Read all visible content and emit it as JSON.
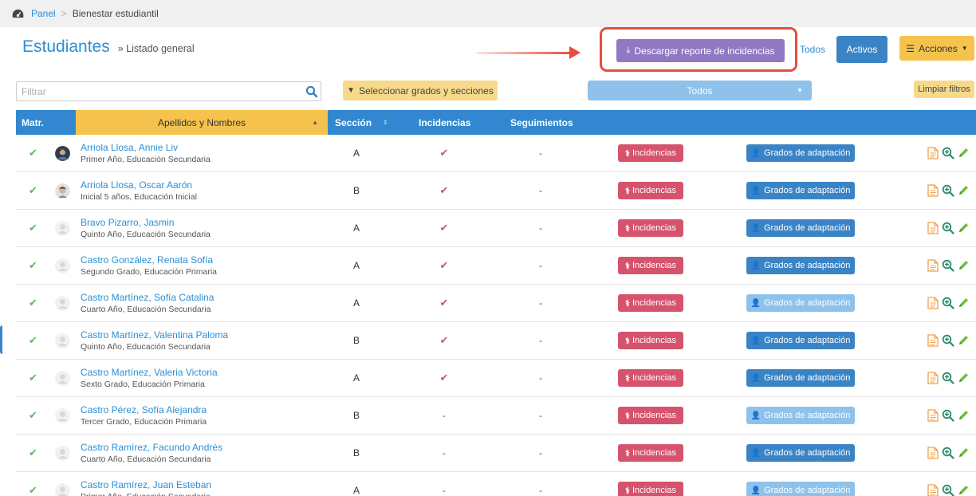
{
  "breadcrumb": {
    "home_icon": "dashboard-icon",
    "link": "Panel",
    "separator": ">",
    "current": "Bienestar estudiantil"
  },
  "page": {
    "title": "Estudiantes",
    "subtitle": "» Listado general"
  },
  "toolbar": {
    "download_icon": "download-icon",
    "download_label": "Descargar reporte de incidencias",
    "todos_label": "Todos",
    "activos_label": "Activos",
    "acciones_label": "Acciones",
    "acciones_icon": "list-icon"
  },
  "filters": {
    "search_placeholder": "Filtrar",
    "grados_label": "Seleccionar grados y secciones",
    "grados_icon": "filter-icon",
    "dropdown_value": "Todos",
    "limpiar_label": "Limpiar filtros"
  },
  "table": {
    "headers": {
      "matr": "Matr.",
      "nombre": "Apellidos y Nombres",
      "seccion": "Sección",
      "incidencias": "Incidencias",
      "seguimientos": "Seguimientos"
    },
    "row_buttons": {
      "incidencias": "Incidencias",
      "grados": "Grados de adaptación"
    },
    "rows": [
      {
        "name": "Arriola Llosa, Annie Liv",
        "grade": "Primer Año, Educación Secundaria",
        "section": "A",
        "incidencias": "✔",
        "seguimientos": "-",
        "avatar": "photo-woman",
        "grados_enabled": true
      },
      {
        "name": "Arriola Llosa, Oscar Aarón",
        "grade": "Inicial 5 años, Educación Inicial",
        "section": "B",
        "incidencias": "✔",
        "seguimientos": "-",
        "avatar": "photo-child",
        "grados_enabled": true
      },
      {
        "name": "Bravo Pizarro, Jasmin",
        "grade": "Quinto Año, Educación Secundaria",
        "section": "A",
        "incidencias": "✔",
        "seguimientos": "-",
        "avatar": "placeholder",
        "grados_enabled": true
      },
      {
        "name": "Castro González, Renata Sofía",
        "grade": "Segundo Grado, Educación Primaria",
        "section": "A",
        "incidencias": "✔",
        "seguimientos": "-",
        "avatar": "placeholder",
        "grados_enabled": true
      },
      {
        "name": "Castro Martínez, Sofía Catalina",
        "grade": "Cuarto Año, Educación Secundaria",
        "section": "A",
        "incidencias": "✔",
        "seguimientos": "-",
        "avatar": "placeholder",
        "grados_enabled": false
      },
      {
        "name": "Castro Martínez, Valentina Paloma",
        "grade": "Quinto Año, Educación Secundaria",
        "section": "B",
        "incidencias": "✔",
        "seguimientos": "-",
        "avatar": "placeholder",
        "grados_enabled": true
      },
      {
        "name": "Castro Martínez, Valeria Victoria",
        "grade": "Sexto Grado, Educación Primaria",
        "section": "A",
        "incidencias": "✔",
        "seguimientos": "-",
        "avatar": "placeholder",
        "grados_enabled": true
      },
      {
        "name": "Castro Pérez, Sofía Alejandra",
        "grade": "Tercer Grado, Educación Primaria",
        "section": "B",
        "incidencias": "-",
        "seguimientos": "-",
        "avatar": "placeholder",
        "grados_enabled": false
      },
      {
        "name": "Castro Ramírez, Facundo Andrés",
        "grade": "Cuarto Año, Educación Secundaria",
        "section": "B",
        "incidencias": "-",
        "seguimientos": "-",
        "avatar": "placeholder",
        "grados_enabled": true
      },
      {
        "name": "Castro Ramírez, Juan Esteban",
        "grade": "Primer Año, Educación Secundaria",
        "section": "A",
        "incidencias": "-",
        "seguimientos": "-",
        "avatar": "placeholder",
        "grados_enabled": false
      }
    ]
  },
  "colors": {
    "primary": "#3287d0",
    "link": "#2a8fd6",
    "purple": "#9178c2",
    "yellow": "#f5c34d",
    "danger": "#d6536d",
    "success": "#5cb85c",
    "highlight": "#e74c3c"
  }
}
